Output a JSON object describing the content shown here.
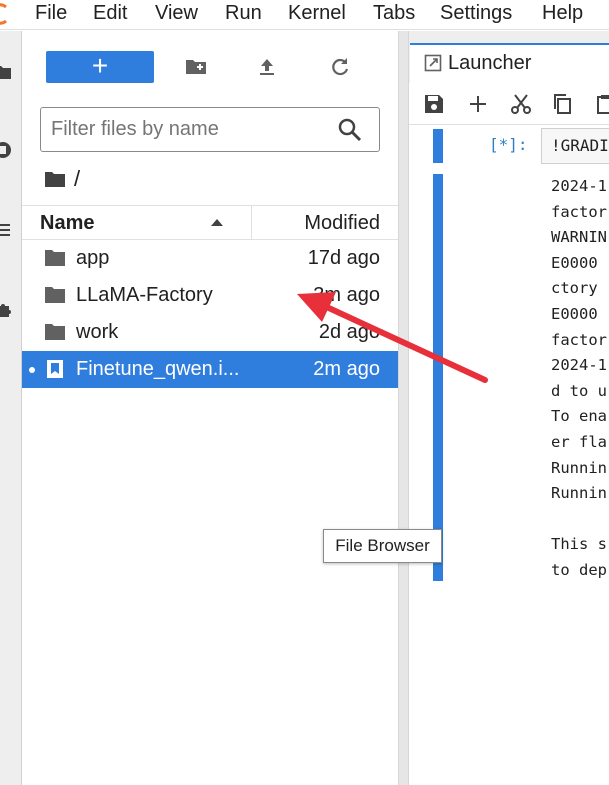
{
  "menu": [
    "File",
    "Edit",
    "View",
    "Run",
    "Kernel",
    "Tabs",
    "Settings",
    "Help"
  ],
  "file_browser": {
    "new_button_label": "+",
    "filter_placeholder": "Filter files by name",
    "breadcrumb": "/",
    "columns": {
      "name": "Name",
      "modified": "Modified"
    },
    "items": [
      {
        "name": "app",
        "modified": "17d ago",
        "type": "folder",
        "selected": false
      },
      {
        "name": "LLaMA-Factory",
        "modified": "3m ago",
        "type": "folder",
        "selected": false
      },
      {
        "name": "work",
        "modified": "2d ago",
        "type": "folder",
        "selected": false
      },
      {
        "name": "Finetune_qwen.i...",
        "modified": "2m ago",
        "type": "notebook",
        "selected": true
      }
    ]
  },
  "tooltip": "File Browser",
  "launcher": {
    "tab_title": "Launcher",
    "prompt": "[*]:",
    "code": "!GRADI",
    "output_lines": [
      "2024-1",
      "factor",
      "WARNIN",
      "E0000 ",
      "ctory ",
      "E0000 ",
      "factor",
      "2024-1",
      "d to u",
      "To ena",
      "er fla",
      "Runnin",
      "Runnin",
      "",
      "This s",
      "to dep"
    ]
  },
  "colors": {
    "accent": "#2f7ddc",
    "annotation_arrow": "#e8303a",
    "logo": "#f37726"
  }
}
